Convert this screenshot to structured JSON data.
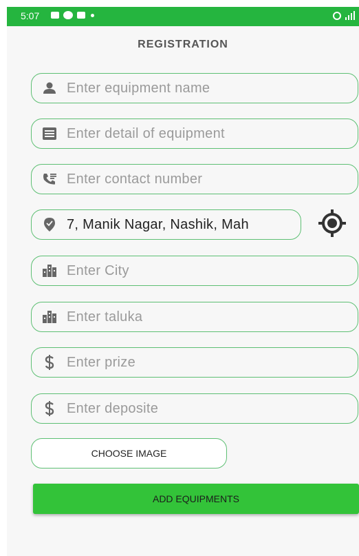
{
  "status_bar": {
    "time": "5:07"
  },
  "title": "REGISTRATION",
  "fields": {
    "equipment_name": {
      "placeholder": "Enter equipment name",
      "icon": "person-icon"
    },
    "equipment_detail": {
      "placeholder": "Enter detail of equipment",
      "icon": "list-icon"
    },
    "contact_number": {
      "placeholder": "Enter contact number",
      "icon": "phone-icon"
    },
    "location": {
      "value": "7, Manik Nagar, Nashik, Mah",
      "icon": "location-pin-icon"
    },
    "city": {
      "placeholder": "Enter City",
      "icon": "city-icon"
    },
    "taluka": {
      "placeholder": "Enter taluka",
      "icon": "city-icon"
    },
    "prize": {
      "placeholder": "Enter prize",
      "icon": "dollar-icon"
    },
    "deposite": {
      "placeholder": "Enter deposite",
      "icon": "dollar-icon"
    }
  },
  "buttons": {
    "choose_image": "CHOOSE IMAGE",
    "add_equipments": "ADD EQUIPMENTS"
  },
  "colors": {
    "status_bar": "#25b53f",
    "field_border": "#5dbf73",
    "primary_button": "#33c339"
  }
}
